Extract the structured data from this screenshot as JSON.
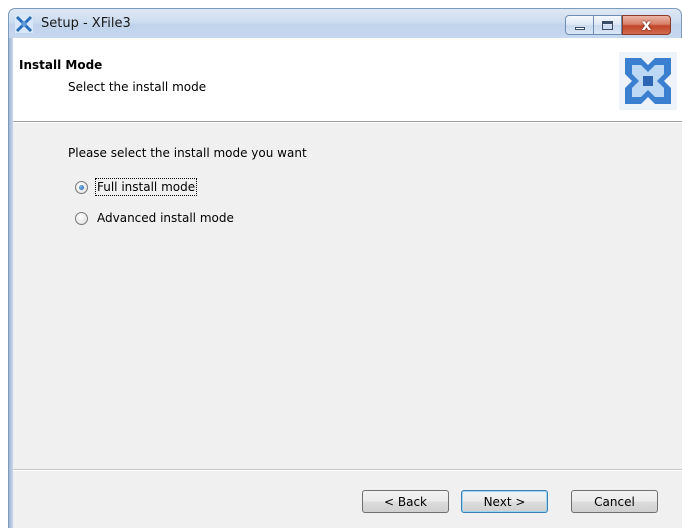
{
  "window": {
    "title": "Setup - XFile3",
    "icon": "xfile-app-icon",
    "controls": {
      "minimize_icon": "minimize-icon",
      "maximize_icon": "maximize-icon",
      "close_glyph": "x",
      "close_icon": "close-icon"
    }
  },
  "header": {
    "title": "Install Mode",
    "subtitle": "Select the install mode",
    "logo": "xfile-logo-icon",
    "logo_color": "#3a7fd0"
  },
  "body": {
    "prompt": "Please select the install mode you want",
    "options": [
      {
        "label": "Full install mode",
        "selected": true
      },
      {
        "label": "Advanced install mode",
        "selected": false
      }
    ]
  },
  "footer": {
    "back_label": "< Back",
    "next_label": "Next >",
    "cancel_label": "Cancel"
  }
}
